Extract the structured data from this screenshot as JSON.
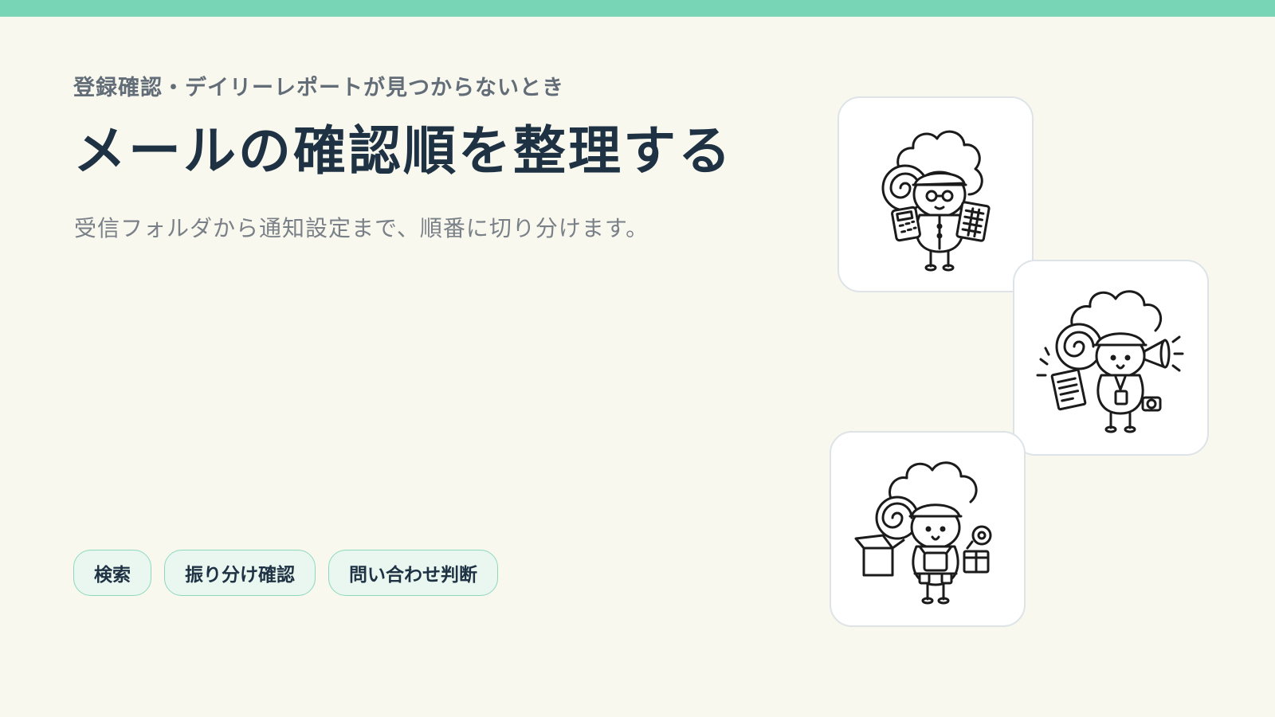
{
  "header": {
    "eyebrow": "登録確認・デイリーレポートが見つからないとき",
    "title": "メールの確認順を整理する",
    "subtitle": "受信フォルダから通知設定まで、順番に切り分けます。"
  },
  "tags": [
    {
      "label": "検索"
    },
    {
      "label": "振り分け確認"
    },
    {
      "label": "問い合わせ判断"
    }
  ],
  "illustrations": [
    {
      "icon": "accountant-sheep-icon"
    },
    {
      "icon": "announcer-sheep-icon"
    },
    {
      "icon": "worker-sheep-icon"
    }
  ],
  "colors": {
    "accent": "#78d6b6",
    "background": "#f9f8ee",
    "title": "#1e3244",
    "tag_background": "#eaf7f0",
    "tag_border": "#8dd8bd"
  }
}
